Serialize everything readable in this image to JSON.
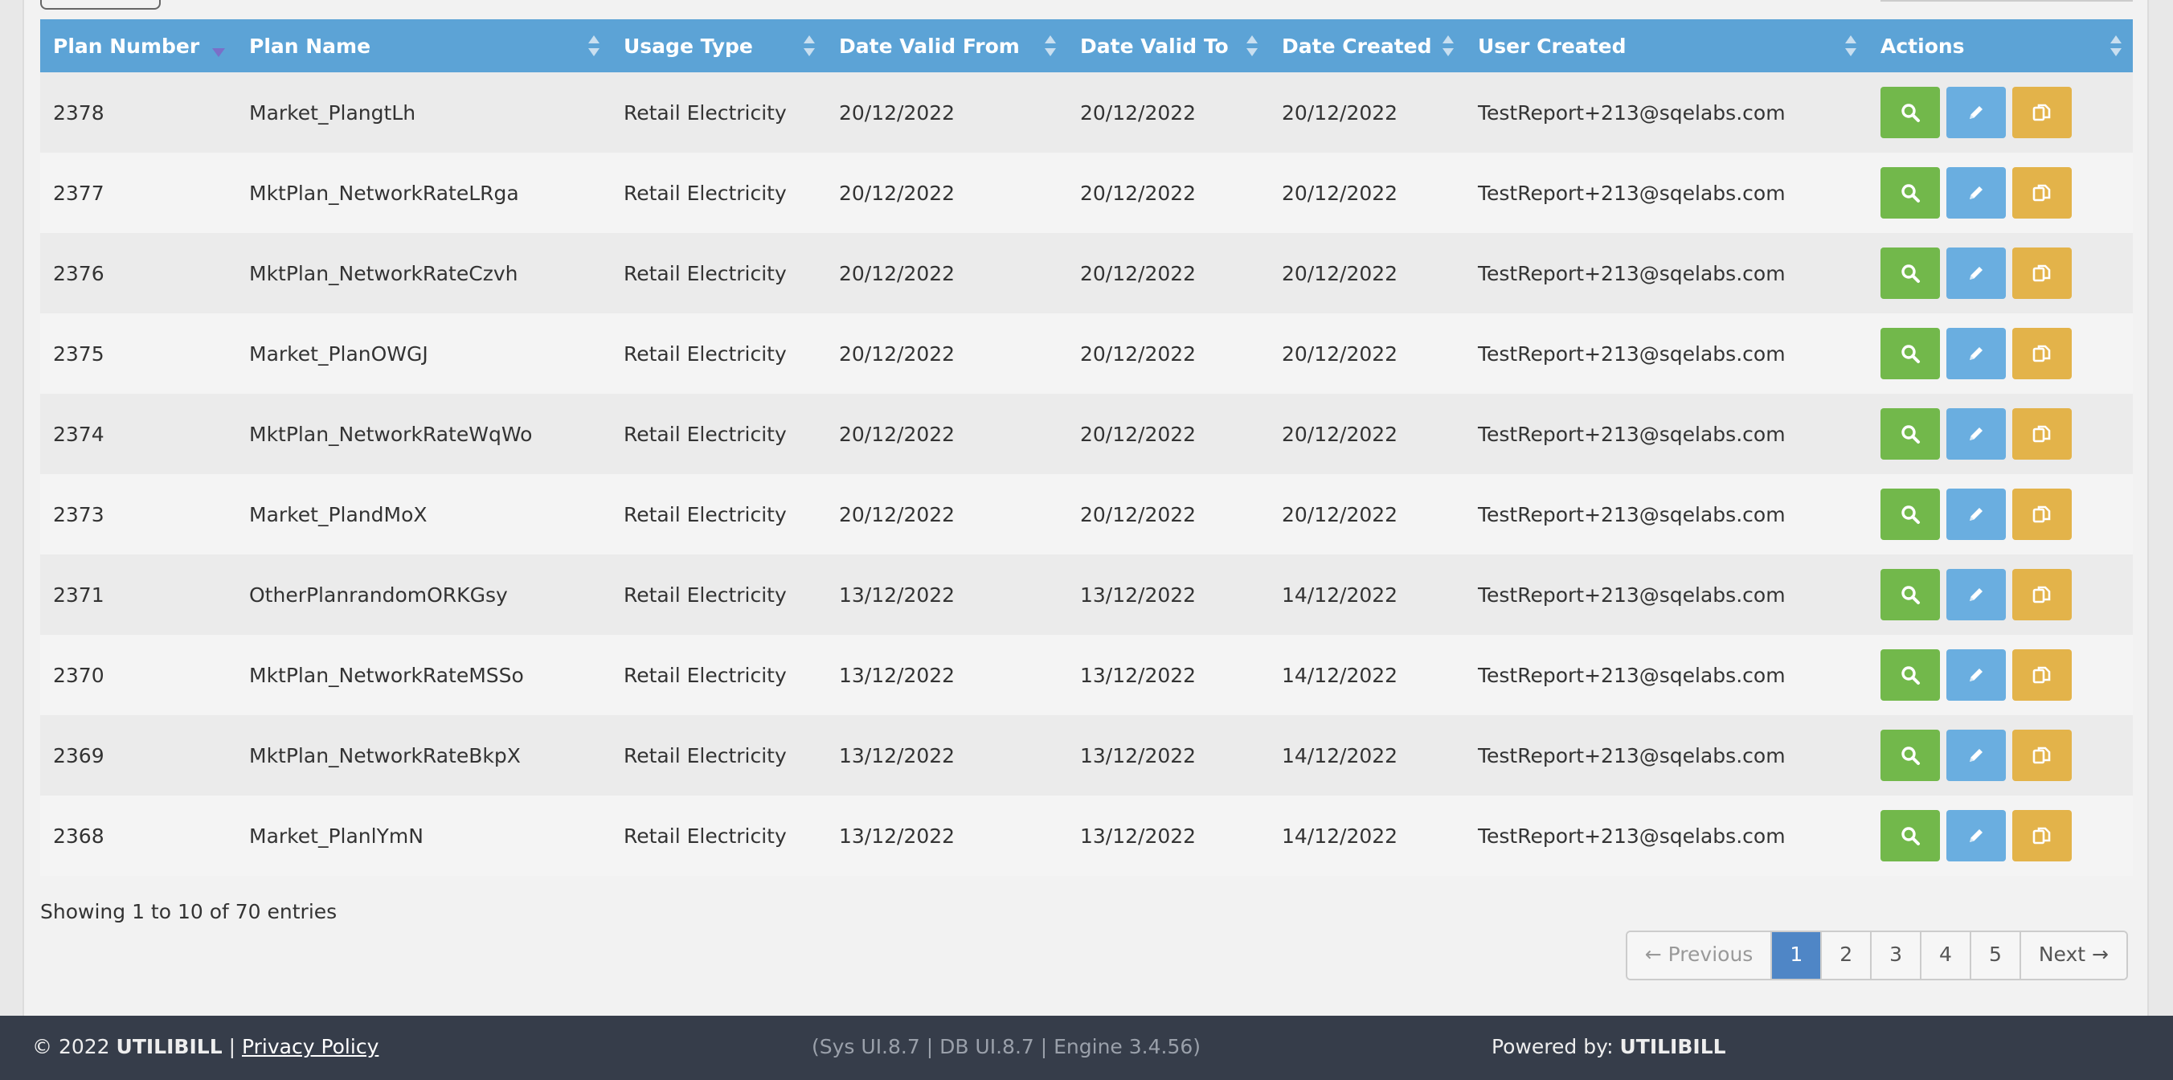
{
  "table": {
    "columns": [
      {
        "label": "Plan Number",
        "sort": "desc"
      },
      {
        "label": "Plan Name",
        "sort": "both"
      },
      {
        "label": "Usage Type",
        "sort": "both"
      },
      {
        "label": "Date Valid From",
        "sort": "both"
      },
      {
        "label": "Date Valid To",
        "sort": "both"
      },
      {
        "label": "Date Created",
        "sort": "both"
      },
      {
        "label": "User Created",
        "sort": "both"
      },
      {
        "label": "Actions",
        "sort": "both"
      }
    ],
    "rows": [
      [
        "2378",
        "Market_PlangtLh",
        "Retail Electricity",
        "20/12/2022",
        "20/12/2022",
        "20/12/2022",
        "TestReport+213@sqelabs.com"
      ],
      [
        "2377",
        "MktPlan_NetworkRateLRga",
        "Retail Electricity",
        "20/12/2022",
        "20/12/2022",
        "20/12/2022",
        "TestReport+213@sqelabs.com"
      ],
      [
        "2376",
        "MktPlan_NetworkRateCzvh",
        "Retail Electricity",
        "20/12/2022",
        "20/12/2022",
        "20/12/2022",
        "TestReport+213@sqelabs.com"
      ],
      [
        "2375",
        "Market_PlanOWGJ",
        "Retail Electricity",
        "20/12/2022",
        "20/12/2022",
        "20/12/2022",
        "TestReport+213@sqelabs.com"
      ],
      [
        "2374",
        "MktPlan_NetworkRateWqWo",
        "Retail Electricity",
        "20/12/2022",
        "20/12/2022",
        "20/12/2022",
        "TestReport+213@sqelabs.com"
      ],
      [
        "2373",
        "Market_PlandMoX",
        "Retail Electricity",
        "20/12/2022",
        "20/12/2022",
        "20/12/2022",
        "TestReport+213@sqelabs.com"
      ],
      [
        "2371",
        "OtherPlanrandomORKGsy",
        "Retail Electricity",
        "13/12/2022",
        "13/12/2022",
        "14/12/2022",
        "TestReport+213@sqelabs.com"
      ],
      [
        "2370",
        "MktPlan_NetworkRateMSSo",
        "Retail Electricity",
        "13/12/2022",
        "13/12/2022",
        "14/12/2022",
        "TestReport+213@sqelabs.com"
      ],
      [
        "2369",
        "MktPlan_NetworkRateBkpX",
        "Retail Electricity",
        "13/12/2022",
        "13/12/2022",
        "14/12/2022",
        "TestReport+213@sqelabs.com"
      ],
      [
        "2368",
        "Market_PlanlYmN",
        "Retail Electricity",
        "13/12/2022",
        "13/12/2022",
        "14/12/2022",
        "TestReport+213@sqelabs.com"
      ]
    ],
    "actions": [
      {
        "name": "view",
        "icon": "search-icon",
        "color": "#72b84b"
      },
      {
        "name": "edit",
        "icon": "pencil-icon",
        "color": "#6aaee0"
      },
      {
        "name": "copy",
        "icon": "copy-icon",
        "color": "#e3b34a"
      }
    ]
  },
  "info_text": "Showing 1 to 10 of 70 entries",
  "pagination": {
    "previous": "← Previous",
    "pages": [
      "1",
      "2",
      "3",
      "4",
      "5"
    ],
    "active_page": "1",
    "next": "Next →"
  },
  "footer": {
    "copyright": "© 2022",
    "brand": "UTILIBILL",
    "separator": "|",
    "privacy": "Privacy Policy",
    "version": "(Sys UI.8.7 | DB UI.8.7 | Engine 3.4.56)",
    "powered_label": "Powered by:",
    "powered_brand": "UTILIBILL"
  },
  "colors": {
    "header": "#5ca3d6",
    "footer": "#363d4a",
    "active_page": "#4f86c6"
  }
}
